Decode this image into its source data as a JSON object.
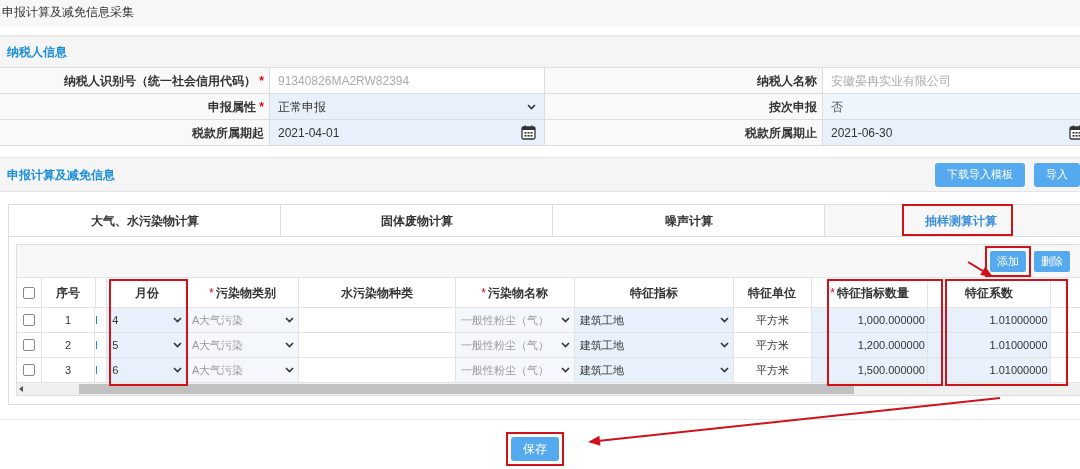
{
  "page_title": "申报计算及减免信息采集",
  "taxpayer_section": {
    "title": "纳税人信息",
    "fields": [
      {
        "label": "纳税人识别号（统一社会信用代码）",
        "required_mark": "*",
        "value": "91340826MA2RW82394",
        "kind": "readonly"
      },
      {
        "label": "纳税人名称",
        "value": "安徽晏冉实业有限公司",
        "kind": "readonly"
      },
      {
        "label": "申报属性",
        "required_mark": "*",
        "value": "正常申报",
        "kind": "select"
      },
      {
        "label": "按次申报",
        "value": "否",
        "kind": "text"
      },
      {
        "label": "税款所属期起",
        "value": "2021-04-01",
        "kind": "date"
      },
      {
        "label": "税款所属期止",
        "value": "2021-06-30",
        "kind": "date"
      }
    ]
  },
  "calc_section": {
    "title": "申报计算及减免信息",
    "buttons": [
      "下载导入模板",
      "导入"
    ],
    "tabs": [
      {
        "label": "大气、水污染物计算",
        "selected": false,
        "highlighted": false
      },
      {
        "label": "固体废物计算",
        "selected": false,
        "highlighted": false
      },
      {
        "label": "噪声计算",
        "selected": false,
        "highlighted": false
      },
      {
        "label": "抽样测算计算",
        "selected": true,
        "highlighted": true
      }
    ],
    "toolbar_buttons": [
      {
        "label": "添加",
        "highlighted": true
      },
      {
        "label": "删除",
        "highlighted": false
      }
    ],
    "select_all_checked": false,
    "columns": [
      {
        "kind": "checkbox",
        "highlighted": false
      },
      {
        "kind": "text",
        "label": "序号",
        "highlighted": false
      },
      {
        "kind": "marker",
        "highlighted": false
      },
      {
        "kind": "text",
        "label": "月份",
        "highlighted": true
      },
      {
        "kind": "text",
        "label": "污染物类别",
        "required_mark": "*",
        "highlighted": false
      },
      {
        "kind": "text",
        "label": "水污染物种类",
        "highlighted": false
      },
      {
        "kind": "text",
        "label": "污染物名称",
        "required_mark": "*",
        "highlighted": false
      },
      {
        "kind": "text",
        "label": "特征指标",
        "highlighted": false
      },
      {
        "kind": "text",
        "label": "特征单位",
        "highlighted": false
      },
      {
        "kind": "text",
        "label": "特征指标数量",
        "required_mark": "*",
        "highlighted": true
      },
      {
        "kind": "text",
        "label": "特征系数",
        "highlighted": true
      }
    ],
    "rows": [
      {
        "checked": false,
        "seq": "1",
        "month": "4",
        "category": "A大气污染",
        "pollutant": "一般性粉尘（气）",
        "indicator": "建筑工地",
        "unit": "平方米",
        "quantity": "1,000.000000",
        "coefficient": "1.01000000"
      },
      {
        "checked": false,
        "seq": "2",
        "month": "5",
        "category": "A大气污染",
        "pollutant": "一般性粉尘（气）",
        "indicator": "建筑工地",
        "unit": "平方米",
        "quantity": "1,200.000000",
        "coefficient": "1.01000000"
      },
      {
        "checked": false,
        "seq": "3",
        "month": "6",
        "category": "A大气污染",
        "pollutant": "一般性粉尘（气）",
        "indicator": "建筑工地",
        "unit": "平方米",
        "quantity": "1,500.000000",
        "coefficient": "1.01000000"
      }
    ]
  },
  "save_button": {
    "label": "保存",
    "highlighted": true
  }
}
